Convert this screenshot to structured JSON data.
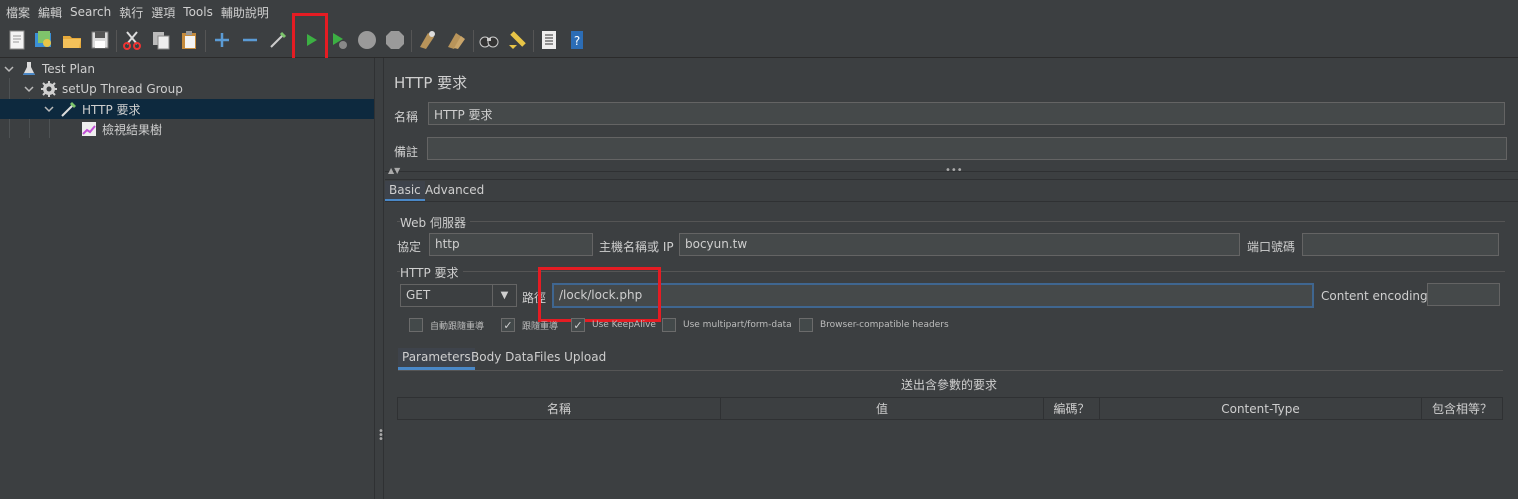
{
  "menu": [
    "檔案",
    "編輯",
    "Search",
    "執行",
    "選項",
    "Tools",
    "輔助說明"
  ],
  "toolbar_icons": [
    "new-icon",
    "templates-icon",
    "open-icon",
    "save-icon",
    "cut-icon",
    "copy-icon",
    "paste-icon",
    "expand-icon",
    "collapse-icon",
    "toggle-icon",
    "start-icon",
    "start-no-pause-icon",
    "stop-icon",
    "shutdown-icon",
    "clear-icon",
    "clear-all-icon",
    "search-icon",
    "reset-search-icon",
    "function-helper-icon",
    "help-icon"
  ],
  "tree": {
    "items": [
      {
        "label": "Test Plan",
        "icon": "flask-icon"
      },
      {
        "label": "setUp Thread Group",
        "icon": "gear-icon"
      },
      {
        "label": "HTTP 要求",
        "icon": "pipette-icon"
      },
      {
        "label": "檢視結果樹",
        "icon": "graph-icon"
      }
    ]
  },
  "panel": {
    "title": "HTTP 要求",
    "name_label": "名稱",
    "name_value": "HTTP 要求",
    "comment_label": "備註",
    "comment_value": "",
    "tabs": [
      "Basic",
      "Advanced"
    ],
    "web_server_group": "Web 伺服器",
    "protocol_label": "協定",
    "protocol_value": "http",
    "host_label": "主機名稱或 IP",
    "host_value": "bocyun.tw",
    "port_label": "端口號碼",
    "port_value": "",
    "http_request_group": "HTTP 要求",
    "method_value": "GET",
    "path_label": "路徑",
    "path_value": "/lock/lock.php",
    "encoding_label": "Content encoding:",
    "encoding_value": "",
    "checkboxes": [
      {
        "label": "自動跟隨重導",
        "checked": false
      },
      {
        "label": "跟隨重導",
        "checked": true
      },
      {
        "label": "Use KeepAlive",
        "checked": true
      },
      {
        "label": "Use multipart/form-data",
        "checked": false
      },
      {
        "label": "Browser-compatible headers",
        "checked": false
      }
    ],
    "param_tabs": [
      "Parameters",
      "Body Data",
      "Files Upload"
    ],
    "params_caption": "送出含參數的要求",
    "columns": [
      "名稱",
      "值",
      "編碼？",
      "Content-Type",
      "包含相等？"
    ]
  },
  "colors": {
    "highlight_box": "#e51c23",
    "selection": "#0d293e",
    "accent": "#4a88c7"
  }
}
